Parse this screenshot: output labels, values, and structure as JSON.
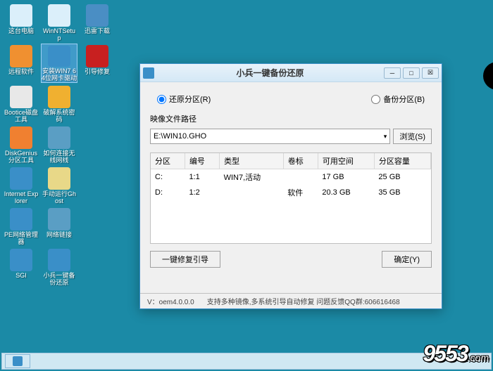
{
  "desktop": {
    "icons": [
      {
        "label": "这台电脑",
        "color": "#dbeffa"
      },
      {
        "label": "WinNTSetup",
        "color": "#dbeffa"
      },
      {
        "label": "迅雷下载",
        "color": "#4a8ec4"
      },
      {
        "label": "远程软件",
        "color": "#f09030"
      },
      {
        "label": "安装WIN7 64位网卡驱动",
        "color": "#3a8fc8",
        "selected": true
      },
      {
        "label": "引导修复",
        "color": "#c82020"
      },
      {
        "label": "Bootice磁盘工具",
        "color": "#e8e8e8"
      },
      {
        "label": "破解系统密码",
        "color": "#f0b030"
      },
      {
        "label": "",
        "color": ""
      },
      {
        "label": "DiskGenius分区工具",
        "color": "#f08030"
      },
      {
        "label": "如何连接无线网线",
        "color": "#5a9ec4"
      },
      {
        "label": "",
        "color": ""
      },
      {
        "label": "Internet Explorer",
        "color": "#3a8fc8"
      },
      {
        "label": "手动运行Ghost",
        "color": "#e8d888"
      },
      {
        "label": "",
        "color": ""
      },
      {
        "label": "PE网络管理器",
        "color": "#3a8fc8"
      },
      {
        "label": "网络链接",
        "color": "#5a9ec4"
      },
      {
        "label": "",
        "color": ""
      },
      {
        "label": "SGI",
        "color": "#3a8fc8"
      },
      {
        "label": "小兵一键备份还原",
        "color": "#3a8fc8"
      },
      {
        "label": "",
        "color": ""
      }
    ]
  },
  "window": {
    "title": "小兵一键备份还原",
    "restore_radio": "还原分区(R)",
    "backup_radio": "备份分区(B)",
    "image_path_label": "映像文件路径",
    "image_path_value": "E:\\WIN10.GHO",
    "browse_btn": "浏览(S)",
    "table": {
      "headers": [
        "分区",
        "编号",
        "类型",
        "卷标",
        "可用空间",
        "分区容量"
      ],
      "rows": [
        [
          "C:",
          "1:1",
          "WIN7,活动",
          "",
          "17 GB",
          "25 GB"
        ],
        [
          "D:",
          "1:2",
          "",
          "软件",
          "20.3 GB",
          "35 GB"
        ]
      ]
    },
    "repair_boot_btn": "一键修复引导",
    "confirm_btn": "确定(Y)",
    "status_version": "V：oem4.0.0.0",
    "status_info": "支持多种镜像,多系统引导自动修复 问题反馈QQ群:606616468"
  },
  "watermark": {
    "main": "9553",
    "sub": ".com"
  }
}
